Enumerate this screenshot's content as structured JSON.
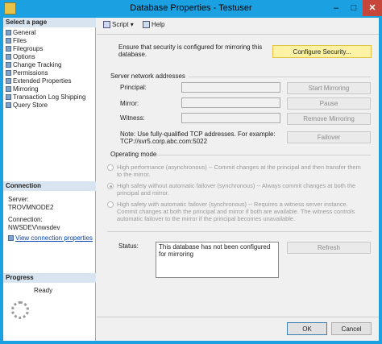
{
  "window": {
    "title": "Database Properties - Testuser",
    "min_glyph": "–",
    "max_glyph": "□",
    "close_glyph": "✕"
  },
  "left": {
    "select_page_header": "Select a page",
    "pages": [
      "General",
      "Files",
      "Filegroups",
      "Options",
      "Change Tracking",
      "Permissions",
      "Extended Properties",
      "Mirroring",
      "Transaction Log Shipping",
      "Query Store"
    ],
    "connection_header": "Connection",
    "server_label": "Server:",
    "server_value": "TROVMNODE2",
    "connection_label": "Connection:",
    "connection_value": "NWSDEV\\nwsdev",
    "view_properties_link": "View connection properties",
    "progress_header": "Progress",
    "progress_status": "Ready"
  },
  "toolbar": {
    "script_label": "Script",
    "help_label": "Help",
    "dropdown_glyph": "▾"
  },
  "mirroring": {
    "security_note": "Ensure that security is configured for mirroring this database.",
    "configure_security_button": "Configure Security...",
    "server_network_addresses_label": "Server network addresses",
    "principal_label": "Principal:",
    "mirror_label": "Mirror:",
    "witness_label": "Witness:",
    "principal_value": "",
    "mirror_value": "",
    "witness_value": "",
    "start_mirroring_button": "Start Mirroring",
    "pause_button": "Pause",
    "remove_mirroring_button": "Remove Mirroring",
    "failover_button": "Failover",
    "note_line1": "Note: Use fully-qualified TCP addresses. For example:",
    "note_line2": "TCP://svr5.corp.abc.com:5022",
    "operating_mode_label": "Operating mode",
    "modes": [
      {
        "line1": "High performance (asynchronous) -- Commit changes at the principal and then transfer them",
        "line2": "to the mirror.",
        "line3": "",
        "checked": false
      },
      {
        "line1": "High safety without automatic failover (synchronous) -- Always commit changes at both the",
        "line2": "principal and mirror.",
        "line3": "",
        "checked": true
      },
      {
        "line1": "High safety with automatic failover (synchronous) -- Requires a witness server instance.",
        "line2": "Commit changes at both the principal and mirror if both are available. The witness controls",
        "line3": "automatic failover to the mirror if the principal becomes unavailable.",
        "checked": false
      }
    ],
    "status_label": "Status:",
    "status_value": "This database has not been configured for mirroring",
    "refresh_button": "Refresh"
  },
  "footer": {
    "ok_button": "OK",
    "cancel_button": "Cancel"
  },
  "colors": {
    "titlebar": "#1ba1e2",
    "close_button": "#c7463b",
    "highlight_button": "#fbf3a3",
    "link": "#0645ad"
  }
}
